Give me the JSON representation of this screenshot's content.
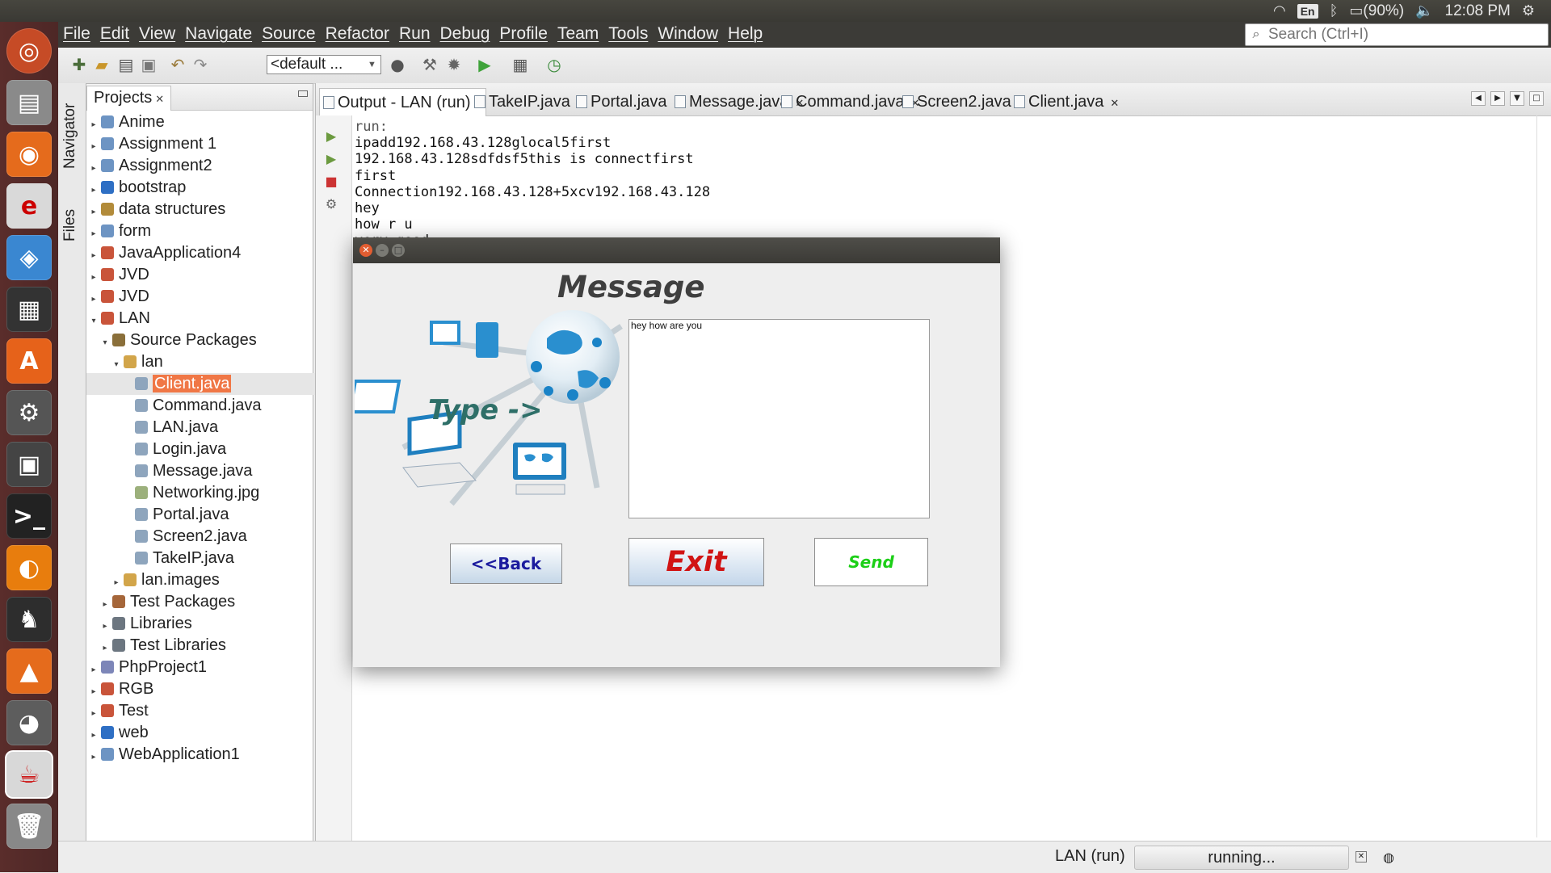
{
  "system_panel": {
    "battery": "(90%)",
    "time": "12:08 PM",
    "keyboard_lang": "En"
  },
  "menubar": {
    "items": [
      "File",
      "Edit",
      "View",
      "Navigate",
      "Source",
      "Refactor",
      "Run",
      "Debug",
      "Profile",
      "Team",
      "Tools",
      "Window",
      "Help"
    ],
    "search_placeholder": "Search (Ctrl+I)"
  },
  "toolbar": {
    "config_value": "<default ..."
  },
  "side_tabs": {
    "navigator": "Navigator",
    "files": "Files"
  },
  "projects_panel": {
    "title": "Projects",
    "tree": [
      {
        "label": "Anime",
        "icon": "web-project-icon"
      },
      {
        "label": "Assignment 1",
        "icon": "web-project-icon"
      },
      {
        "label": "Assignment2",
        "icon": "web-project-icon"
      },
      {
        "label": "bootstrap",
        "icon": "html5-project-icon"
      },
      {
        "label": "data structures",
        "icon": "project-icon"
      },
      {
        "label": "form",
        "icon": "web-project-icon"
      },
      {
        "label": "JavaApplication4",
        "icon": "java-project-icon"
      },
      {
        "label": "JVD",
        "icon": "java-project-icon"
      },
      {
        "label": "JVD",
        "icon": "java-project-icon"
      },
      {
        "label": "LAN",
        "icon": "java-project-icon"
      },
      {
        "label": "Source Packages",
        "icon": "source-packages-icon"
      },
      {
        "label": "lan",
        "icon": "package-icon"
      },
      {
        "label": "Client.java",
        "icon": "java-file-icon"
      },
      {
        "label": "Command.java",
        "icon": "java-file-icon"
      },
      {
        "label": "LAN.java",
        "icon": "java-file-icon"
      },
      {
        "label": "Login.java",
        "icon": "java-file-icon"
      },
      {
        "label": "Message.java",
        "icon": "java-file-icon"
      },
      {
        "label": "Networking.jpg",
        "icon": "image-file-icon"
      },
      {
        "label": "Portal.java",
        "icon": "java-file-icon"
      },
      {
        "label": "Screen2.java",
        "icon": "java-file-icon"
      },
      {
        "label": "TakeIP.java",
        "icon": "java-file-icon"
      },
      {
        "label": "lan.images",
        "icon": "package-icon"
      },
      {
        "label": "Test Packages",
        "icon": "test-packages-icon"
      },
      {
        "label": "Libraries",
        "icon": "libraries-icon"
      },
      {
        "label": "Test Libraries",
        "icon": "libraries-icon"
      },
      {
        "label": "PhpProject1",
        "icon": "php-project-icon"
      },
      {
        "label": "RGB",
        "icon": "java-project-icon"
      },
      {
        "label": "Test",
        "icon": "java-project-icon"
      },
      {
        "label": "web",
        "icon": "html5-project-icon"
      },
      {
        "label": "WebApplication1",
        "icon": "web-project-icon"
      }
    ],
    "selected": "Client.java"
  },
  "editor_tabs": [
    {
      "label": "Output - LAN (run)",
      "active": true
    },
    {
      "label": "TakeIP.java",
      "active": false
    },
    {
      "label": "Portal.java",
      "active": false
    },
    {
      "label": "Message.java",
      "active": false
    },
    {
      "label": "Command.java",
      "active": false
    },
    {
      "label": "Screen2.java",
      "active": false
    },
    {
      "label": "Client.java",
      "active": false
    }
  ],
  "output": {
    "lines": [
      "run:",
      "ipadd192.168.43.128glocal5first",
      "192.168.43.128sdfdsf5this is connectfirst",
      "first",
      "Connection192.168.43.128+5xcv192.168.43.128",
      "hey",
      "how r u",
      "very good"
    ]
  },
  "status_bar": {
    "process": "LAN (run)",
    "state": "running..."
  },
  "dialog": {
    "title": "Message",
    "type_label": "Type ->",
    "message_text": "hey how are you",
    "back_label": "<<Back",
    "exit_label": "Exit",
    "send_label": "Send"
  },
  "colors": {
    "selection": "#f07746",
    "exit_text": "#d11414",
    "send_text": "#1ccf17",
    "back_text": "#1b1b9e",
    "launcher_bg": "#5a2d2b"
  }
}
